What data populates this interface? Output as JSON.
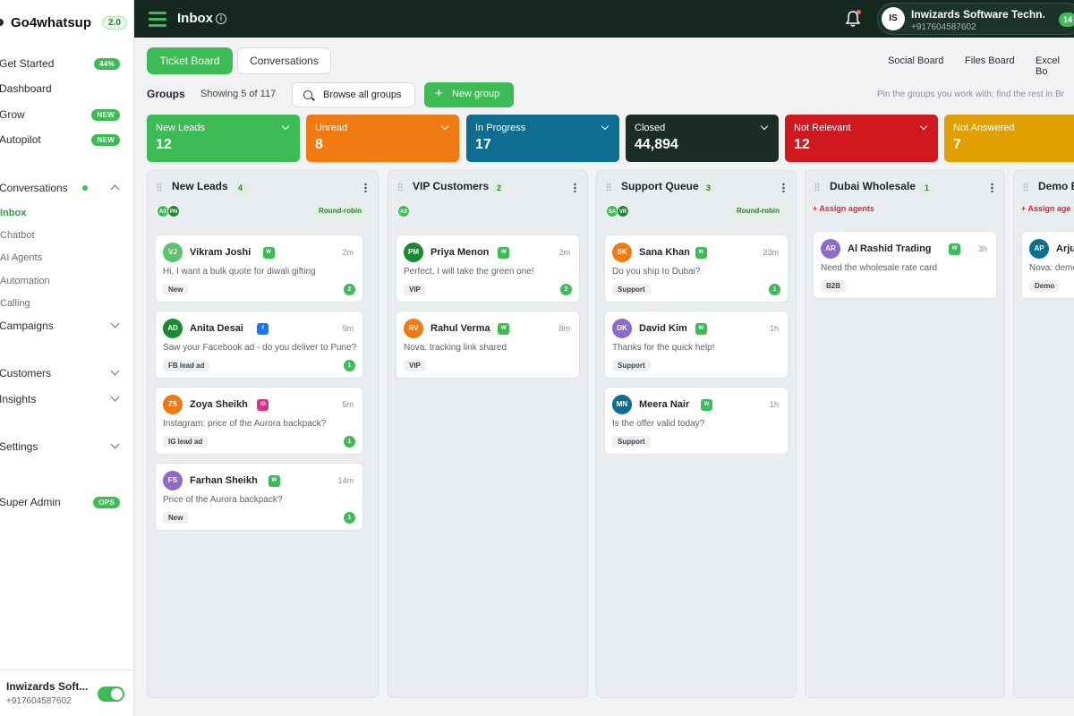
{
  "brand": {
    "name": "Go4whatsup",
    "version": "2.0"
  },
  "sidebar": {
    "items": [
      {
        "label": "Get Started",
        "badge": "44%"
      },
      {
        "label": "Dashboard"
      },
      {
        "label": "Grow",
        "badge": "NEW"
      },
      {
        "label": "Autopilot",
        "badge": "NEW"
      },
      {
        "label": "Conversations"
      },
      {
        "label": "Campaigns"
      },
      {
        "label": "Customers"
      },
      {
        "label": "Insights"
      },
      {
        "label": "Settings"
      },
      {
        "label": "Super Admin",
        "badge": "OPS"
      }
    ],
    "sub_items": [
      "Inbox",
      "Chatbot",
      "AI Agents",
      "Automation",
      "Calling"
    ],
    "footer": {
      "name": "Inwizards Soft...",
      "phone": "+917604587602"
    }
  },
  "topbar": {
    "title": "Inbox",
    "account": {
      "initials": "IS",
      "name": "Inwizards Software Techn...",
      "phone": "+917604587602",
      "count": "14"
    }
  },
  "tabs": [
    {
      "label": "Ticket Board"
    },
    {
      "label": "Conversations"
    }
  ],
  "board_links": [
    "Social Board",
    "Files Board",
    "Excel Bo"
  ],
  "groups": {
    "title": "Groups",
    "showing": "Showing 5 of 117",
    "browse_label": "Browse all groups",
    "new_label": "New group",
    "hint": "Pin the groups you work with; find the rest in Br"
  },
  "status_tiles": [
    {
      "label": "New Leads",
      "value": "12",
      "color": "#3dbb55"
    },
    {
      "label": "Unread",
      "value": "8",
      "color": "#ef7a12"
    },
    {
      "label": "In Progress",
      "value": "17",
      "color": "#0d6e92"
    },
    {
      "label": "Closed",
      "value": "44,894",
      "color": "#1b2d25"
    },
    {
      "label": "Not Relevant",
      "value": "12",
      "color": "#d0191f"
    },
    {
      "label": "Not Answered",
      "value": "7",
      "color": "#e0a100"
    }
  ],
  "columns": [
    {
      "title": "New Leads",
      "count": "4",
      "agents": [
        "AS",
        "PN"
      ],
      "routing": "Round-robin",
      "cards": [
        {
          "initials": "VJ",
          "name": "Vikram Joshi",
          "channel": "W",
          "time": "2m",
          "message": "Hi, I want a bulk quote for diwali gifting",
          "tag": "New",
          "unread": "2",
          "color": "#5cc36a"
        },
        {
          "initials": "AD",
          "name": "Anita Desai",
          "channel": "f",
          "time": "9m",
          "message": "Saw your Facebook ad - do you deliver to Pune?",
          "tag": "FB lead ad",
          "unread": "1",
          "color": "#1a8a32"
        },
        {
          "initials": "ZS",
          "name": "Zoya Sheikh",
          "channel": "IG",
          "time": "5m",
          "message": "Instagram: price of the Aurora backpack?",
          "tag": "IG lead ad",
          "unread": "1",
          "color": "#ef7a12"
        },
        {
          "initials": "FS",
          "name": "Farhan Sheikh",
          "channel": "W",
          "time": "14m",
          "message": "Price of the Aurora backpack?",
          "tag": "New",
          "unread": "1",
          "color": "#8e6bc9"
        }
      ]
    },
    {
      "title": "VIP Customers",
      "count": "2",
      "agents": [
        "AS"
      ],
      "routing": "",
      "cards": [
        {
          "initials": "PM",
          "name": "Priya Menon",
          "channel": "W",
          "time": "2m",
          "message": "Perfect, I will take the green one!",
          "tag": "VIP",
          "unread": "2",
          "color": "#1a8a32"
        },
        {
          "initials": "RV",
          "name": "Rahul Verma",
          "channel": "W",
          "time": "8m",
          "message": "Nova: tracking link shared",
          "tag": "VIP",
          "unread": "",
          "color": "#ef7a12"
        }
      ]
    },
    {
      "title": "Support Queue",
      "count": "3",
      "agents": [
        "SA",
        "VR"
      ],
      "routing": "Round-robin",
      "cards": [
        {
          "initials": "SK",
          "name": "Sana Khan",
          "channel": "W",
          "time": "23m",
          "message": "Do you ship to Dubai?",
          "tag": "Support",
          "unread": "1",
          "color": "#ef7a12"
        },
        {
          "initials": "DK",
          "name": "David Kim",
          "channel": "W",
          "time": "1h",
          "message": "Thanks for the quick help!",
          "tag": "Support",
          "unread": "",
          "color": "#8e6bc9"
        },
        {
          "initials": "MN",
          "name": "Meera Nair",
          "channel": "W",
          "time": "1h",
          "message": "Is the offer valid today?",
          "tag": "Support",
          "unread": "",
          "color": "#0d6e92"
        }
      ]
    },
    {
      "title": "Dubai Wholesale",
      "count": "1",
      "assign": "+ Assign agents",
      "cards": [
        {
          "initials": "AR",
          "name": "Al Rashid Trading",
          "channel": "W",
          "time": "3h",
          "message": "Need the wholesale rate card",
          "tag": "B2B",
          "unread": "",
          "color": "#8e6bc9"
        }
      ]
    },
    {
      "title": "Demo B",
      "count": "",
      "assign": "+ Assign age",
      "cards": [
        {
          "initials": "AP",
          "name": "Arju",
          "channel": "",
          "time": "",
          "message": "Nova: demo",
          "tag": "Demo",
          "unread": "",
          "color": "#0d6e92"
        }
      ]
    }
  ]
}
